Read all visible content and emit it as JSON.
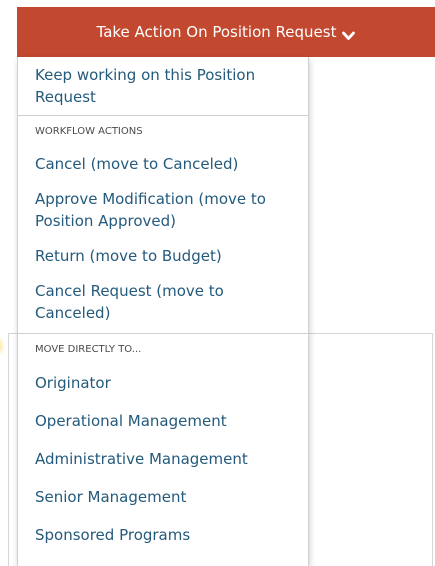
{
  "action_button": {
    "label": "Take Action On Position Request",
    "icon": "chevron-down-icon",
    "color": "#c2482f"
  },
  "dropdown": {
    "keep_working": "Keep working on this Position Request",
    "sections": [
      {
        "header": "WORKFLOW ACTIONS",
        "items": [
          "Cancel (move to Canceled)",
          "Approve Modification (move to Position Approved)",
          "Return (move to Budget)",
          "Cancel Request (move to Canceled)"
        ]
      },
      {
        "header": "MOVE DIRECTLY TO...",
        "items": [
          "Originator",
          "Operational Management",
          "Administrative Management",
          "Senior Management",
          "Sponsored Programs"
        ]
      }
    ],
    "link_color": "#245a7c"
  }
}
